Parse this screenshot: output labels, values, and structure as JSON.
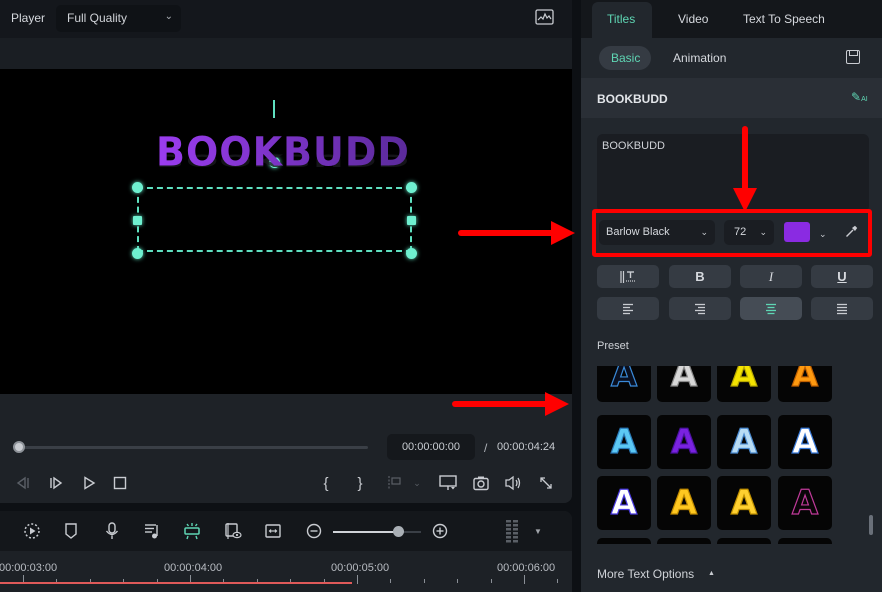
{
  "player": {
    "label": "Player",
    "quality": "Full Quality",
    "canvas_text": "BOOKBUDD",
    "timecode_current": "00:00:00:00",
    "timecode_separator": "/",
    "timecode_total": "00:00:04:24",
    "playback_progress": 0
  },
  "controls": {
    "icons": [
      "previous-frame-icon",
      "next-frame-icon",
      "play-icon",
      "stop-icon",
      "mark-in-icon",
      "mark-out-icon",
      "marker-icon",
      "display-icon",
      "snapshot-icon",
      "volume-icon",
      "fullscreen-icon"
    ],
    "mark_in": "{",
    "mark_out": "}"
  },
  "timeline": {
    "zoom_level": 0.75,
    "ruler_labels": [
      "00:00:03:00",
      "00:00:04:00",
      "00:00:05:00",
      "00:00:06:00"
    ]
  },
  "panel": {
    "tabs": [
      {
        "label": "Titles",
        "active": true
      },
      {
        "label": "Video",
        "active": false
      },
      {
        "label": "Text To Speech",
        "active": false
      }
    ],
    "subtabs": [
      {
        "label": "Basic",
        "active": true
      },
      {
        "label": "Animation",
        "active": false
      }
    ],
    "section_title": "BOOKBUDD",
    "ai_label": "AI",
    "text_value": "BOOKBUDD",
    "font": "Barlow Black",
    "font_size": "72",
    "font_color": "#8a2be2",
    "format_buttons": {
      "bold": "B",
      "italic": "I",
      "underline": "U"
    },
    "alignment_active": "center",
    "preset_label": "Preset",
    "preset_glyph": "A",
    "presets": [
      {
        "name": "blue-outline",
        "color": "#0a1020",
        "stroke": "#3a8ad8"
      },
      {
        "name": "silver",
        "color": "#d8d8d8",
        "stroke": "#8a8a8a"
      },
      {
        "name": "yellow",
        "color": "#f4e400",
        "stroke": "#b8a800"
      },
      {
        "name": "orange",
        "color": "#ff9a10",
        "stroke": "#c06000"
      },
      {
        "name": "cyan",
        "color": "#5cc8f4",
        "stroke": "#2a7ab8"
      },
      {
        "name": "purple",
        "color": "#7a22e0",
        "stroke": "#4a12a0"
      },
      {
        "name": "ice",
        "color": "#b8dcf4",
        "stroke": "#4a8ad0"
      },
      {
        "name": "white-glow",
        "color": "#ffffff",
        "stroke": "#3a7ad8"
      },
      {
        "name": "white-violet",
        "color": "#ffffff",
        "stroke": "#4a3ae0"
      },
      {
        "name": "gold",
        "color": "#ffc820",
        "stroke": "#c08a00"
      },
      {
        "name": "gold-light",
        "color": "#ffd030",
        "stroke": "#c09000"
      },
      {
        "name": "pink-outline",
        "color": "#0a0508",
        "stroke": "#c03a9a"
      }
    ],
    "more_options": "More Text Options"
  }
}
